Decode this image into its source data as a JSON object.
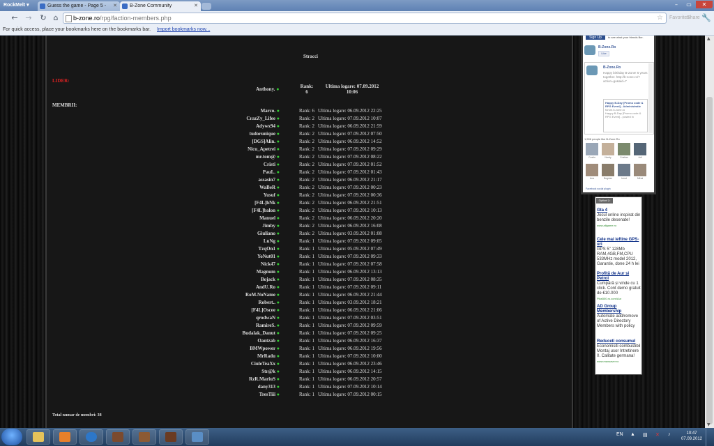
{
  "browser": {
    "menu_label": "RockMelt",
    "tabs": [
      {
        "label": "Guess the game - Page 5 -",
        "active": false
      },
      {
        "label": "B-Zone Community",
        "active": true
      }
    ],
    "url_host": "b-zone.ro",
    "url_path": "/rpg/faction-members.php",
    "toolbar_right": [
      "Favorites",
      "Share"
    ],
    "bookmarks_message": "For quick access, place your bookmarks here on the bookmarks bar.",
    "bookmarks_link": "Import bookmarks now..."
  },
  "faction": {
    "title": "Stracci",
    "leader_label": "LIDER:",
    "leader": {
      "name": "Anthony.",
      "rank_label": "Rank:",
      "rank": "6",
      "login_label": "Ultima logare:",
      "login": "07.09.2012",
      "login_time": "10:06"
    },
    "members_label": "MEMBRII:",
    "members": [
      {
        "name": "Marco.",
        "rank": "Rank: 6",
        "login": "Ultima logare: 06.09.2012 22:25"
      },
      {
        "name": "CrazZy_Lifee",
        "rank": "Rank: 2",
        "login": "Ultima logare: 07.09.2012 10:07"
      },
      {
        "name": "Adywx94",
        "rank": "Rank: 2",
        "login": "Ultima logare: 06.09.2012 21:59"
      },
      {
        "name": "tudorunique",
        "rank": "Rank: 2",
        "login": "Ultima logare: 07.09.2012 07:50"
      },
      {
        "name": "[DGS]Alin.",
        "rank": "Rank: 2",
        "login": "Ultima logare: 06.09.2012 14:52"
      },
      {
        "name": "Nicu_Apetrei",
        "rank": "Rank: 2",
        "login": "Ultima logare: 07.09.2012 09:29"
      },
      {
        "name": "mr.tom@",
        "rank": "Rank: 2",
        "login": "Ultima logare: 07.09.2012 08:22"
      },
      {
        "name": "Cristi",
        "rank": "Rank: 2",
        "login": "Ultima logare: 07.09.2012 01:52"
      },
      {
        "name": "PauL.",
        "rank": "Rank: 2",
        "login": "Ultima logare: 07.09.2012 01:43"
      },
      {
        "name": "assasin7",
        "rank": "Rank: 2",
        "login": "Ultima logare: 06.09.2012 21:17"
      },
      {
        "name": "WaBeR",
        "rank": "Rank: 2",
        "login": "Ultima logare: 07.09.2012 00:23"
      },
      {
        "name": "Yusuf",
        "rank": "Rank: 2",
        "login": "Ultima logare: 07.09.2012 00:36"
      },
      {
        "name": "[F4L]hNk",
        "rank": "Rank: 2",
        "login": "Ultima logare: 06.09.2012 21:51"
      },
      {
        "name": "[F4L]balon",
        "rank": "Rank: 2",
        "login": "Ultima logare: 07.09.2012 10:13"
      },
      {
        "name": "Manuel",
        "rank": "Rank: 2",
        "login": "Ultima logare: 06.09.2012 20:20"
      },
      {
        "name": "Jimby",
        "rank": "Rank: 2",
        "login": "Ultima logare: 06.09.2012 16:08"
      },
      {
        "name": "Giuliano",
        "rank": "Rank: 2",
        "login": "Ultima logare: 03.09.2012 01:08"
      },
      {
        "name": "LuNg",
        "rank": "Rank: 1",
        "login": "Ultima logare: 07.09.2012 09:05"
      },
      {
        "name": "TzqOn1",
        "rank": "Rank: 1",
        "login": "Ultima logare: 05.09.2012 07:49"
      },
      {
        "name": "YoNut01",
        "rank": "Rank: 1",
        "login": "Ultima logare: 07.09.2012 09:33"
      },
      {
        "name": "Nick47",
        "rank": "Rank: 1",
        "login": "Ultima logare: 07.09.2012 07:58"
      },
      {
        "name": "Magnum",
        "rank": "Rank: 1",
        "login": "Ultima logare: 06.09.2012 13:13"
      },
      {
        "name": "Bojack",
        "rank": "Rank: 1",
        "login": "Ultima logare: 07.09.2012 08:35"
      },
      {
        "name": "AndU.Ro",
        "rank": "Rank: 1",
        "login": "Ultima logare: 07.09.2012 09:11"
      },
      {
        "name": "RoM.NoName",
        "rank": "Rank: 1",
        "login": "Ultima logare: 06.09.2012 21:44"
      },
      {
        "name": "Robert..",
        "rank": "Rank: 1",
        "login": "Ultima logare: 03.09.2012 18:21"
      },
      {
        "name": "[F4L]Oscee",
        "rank": "Rank: 1",
        "login": "Ultima logare: 06.09.2012 21:06"
      },
      {
        "name": "qrodwaN",
        "rank": "Rank: 1",
        "login": "Ultima logare: 07.09.2012 03:51"
      },
      {
        "name": "RamireS.",
        "rank": "Rank: 1",
        "login": "Ultima logare: 07.09.2012 09:59"
      },
      {
        "name": "Budalak_Danut",
        "rank": "Rank: 1",
        "login": "Ultima logare: 07.09.2012 09:25"
      },
      {
        "name": "Oantzab",
        "rank": "Rank: 1",
        "login": "Ultima logare: 06.09.2012 16:37"
      },
      {
        "name": "BMWpower",
        "rank": "Rank: 1",
        "login": "Ultima logare: 06.09.2012 19:56"
      },
      {
        "name": "MrRadu",
        "rank": "Rank: 1",
        "login": "Ultima logare: 07.09.2012 10:00"
      },
      {
        "name": "CiuleTeaXx",
        "rank": "Rank: 1",
        "login": "Ultima logare: 06.09.2012 23:46"
      },
      {
        "name": "Str@k",
        "rank": "Rank: 1",
        "login": "Ultima logare: 06.09.2012 14:15"
      },
      {
        "name": "RzR.MariuS",
        "rank": "Rank: 1",
        "login": "Ultima logare: 06.09.2012 20:57"
      },
      {
        "name": "dany313",
        "rank": "Rank: 1",
        "login": "Ultima logare: 07.09.2012 10:14"
      },
      {
        "name": "TresTiii",
        "rank": "Rank: 1",
        "login": "Ultima logare: 07.09.2012 00:15"
      }
    ],
    "total": "Total numar de membri: 38"
  },
  "facebook": {
    "signup": "Sign Up",
    "friends_text": "to see what your friends like.",
    "page_name": "B-Zone.Ro",
    "like_label": "Like",
    "post_author": "B-Zone.Ro",
    "post_text": "Happy birthday B-Zone! 6 years together. http://b-zone.ro/?action=go&aid=7",
    "card_title": "Happy B-Day [Promo code & RPG Event] - Administratie",
    "card_source": "forum.b-zone.ro",
    "card_text": "Happy B-Day [Promo code & RPG Event] - posted in",
    "like_count": "1,596 people like B-Zone.Ro",
    "faces": [
      "Costin",
      "Nardy",
      "Cristian",
      "Adi",
      "Ana",
      "Bogdan",
      "Ionut",
      "Mihai"
    ],
    "plugin": "Facebook social plugin"
  },
  "ads": {
    "options": "Optiuni",
    "items": [
      {
        "title": "Gta 4",
        "text": "Jocul online inspirat din benzile desenate!",
        "url": "www.allgame.ro"
      },
      {
        "title": "Cele mai ieftine GPS-uri",
        "text": "GPS 5\" 128Mb RAM,4GB,FM,CPU 533MHz model 2012, Garantie, done 24 h lei",
        "url": ""
      },
      {
        "title": "Profită de Aur și Petrol",
        "text": "Cumpără și vinde cu 1 click. Cont demo gratuit de €10.000",
        "url": "Plus500.ro.com/Aur"
      },
      {
        "title": "AD Group Membership",
        "text": "Automate add/remove of Active Directory Members with policy",
        "url": ""
      },
      {
        "title": "Reduceti consumul",
        "text": "Economisiti combustibil Montaj usor Intretinere 0. Calitate germana!",
        "url": "www.maxsaver.ro"
      }
    ]
  },
  "taskbar": {
    "lang": "EN",
    "time": "10:47",
    "date": "07.09.2012"
  },
  "colors": {
    "leader_red": "#dd2222",
    "online_green": "#33cc33",
    "page_bg": "#171717"
  }
}
